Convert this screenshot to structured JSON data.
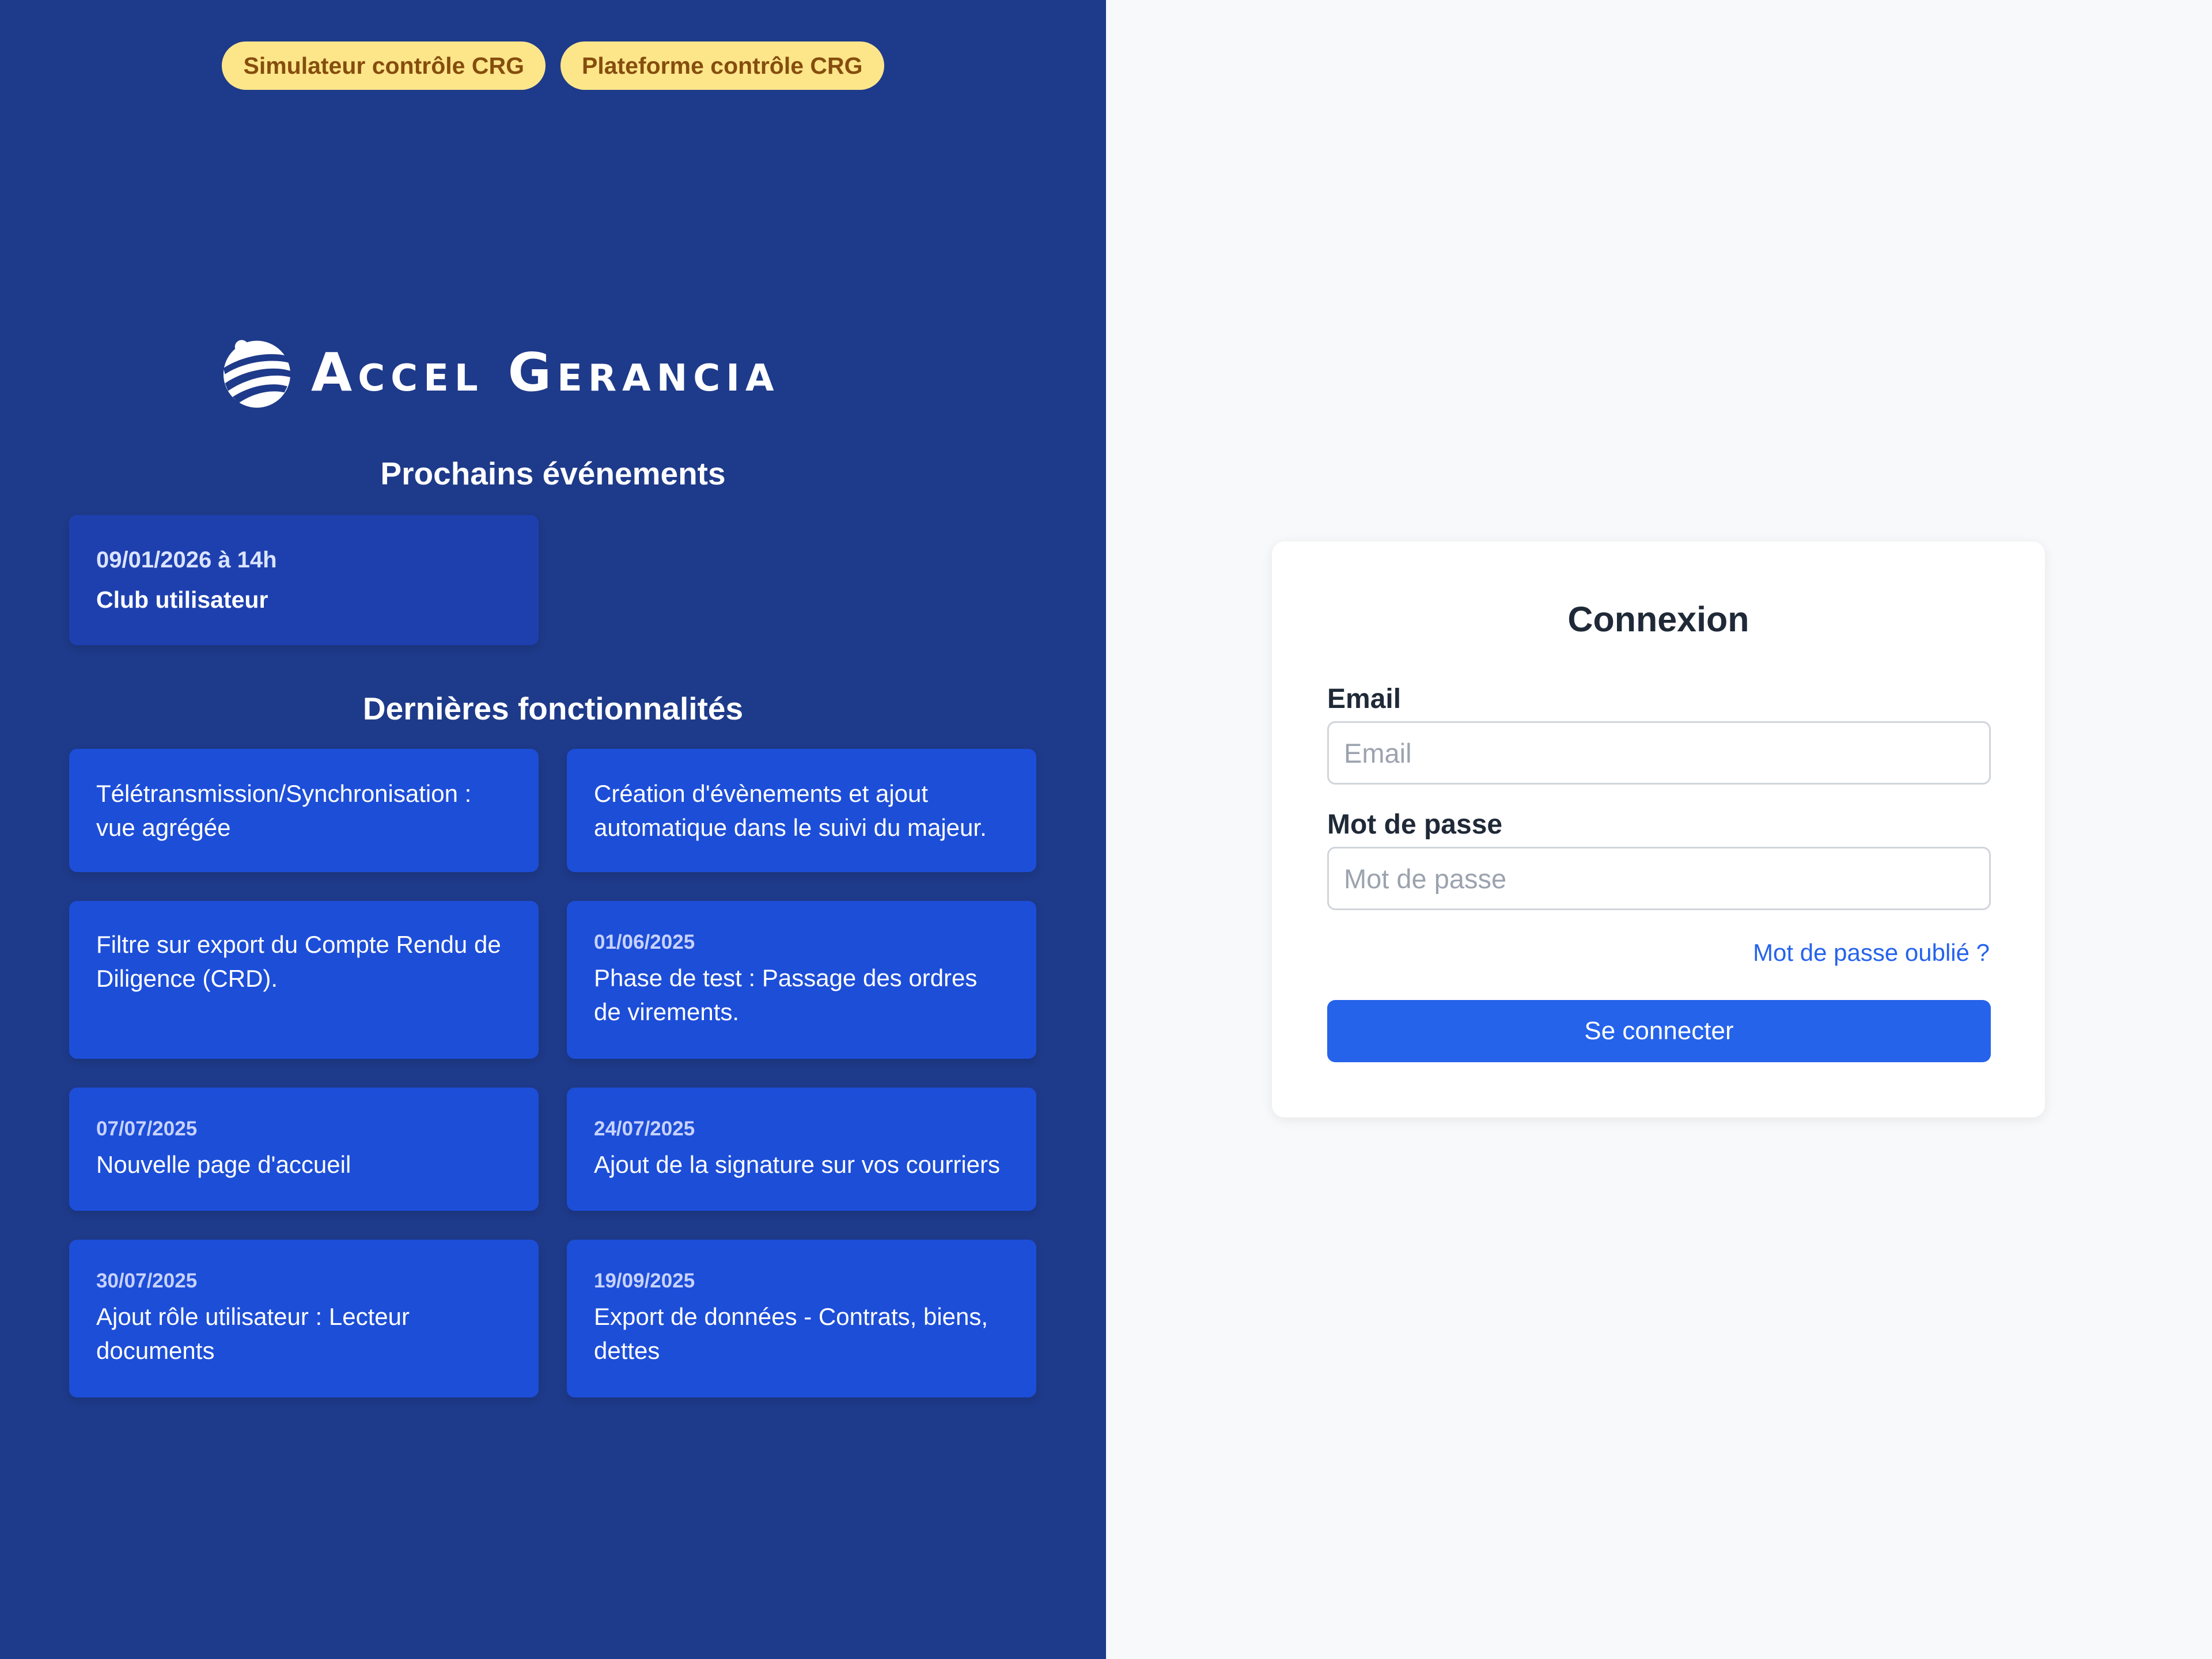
{
  "top_badges": [
    "Simulateur contrôle CRG",
    "Plateforme contrôle CRG"
  ],
  "logo": {
    "text": "Accel Gerancia"
  },
  "events": {
    "heading": "Prochains événements",
    "items": [
      {
        "date": "09/01/2026 à 14h",
        "title": "Club utilisateur"
      }
    ]
  },
  "features": {
    "heading": "Dernières fonctionnalités",
    "items": [
      {
        "date": "",
        "title": "Télétransmission/Synchronisation : vue agrégée"
      },
      {
        "date": "",
        "title": "Création d'évènements et ajout automatique dans le suivi du majeur."
      },
      {
        "date": "",
        "title": "Filtre sur export du Compte Rendu de Diligence (CRD)."
      },
      {
        "date": "01/06/2025",
        "title": "Phase de test : Passage des ordres de virements."
      },
      {
        "date": "07/07/2025",
        "title": "Nouvelle page d'accueil"
      },
      {
        "date": "24/07/2025",
        "title": "Ajout de la signature sur vos courriers"
      },
      {
        "date": "30/07/2025",
        "title": "Ajout rôle utilisateur : Lecteur documents"
      },
      {
        "date": "19/09/2025",
        "title": "Export de données - Contrats, biens, dettes"
      }
    ]
  },
  "login": {
    "title": "Connexion",
    "email_label": "Email",
    "email_placeholder": "Email",
    "email_value": "",
    "password_label": "Mot de passe",
    "password_placeholder": "Mot de passe",
    "password_value": "",
    "forgot_link": "Mot de passe oublié ?",
    "submit_label": "Se connecter"
  },
  "colors": {
    "left_panel_bg": "#1e3a8a",
    "card_bg": "#1d4ed8",
    "badge_bg": "#fde68a",
    "badge_text": "#854d0e",
    "primary": "#2563eb"
  }
}
